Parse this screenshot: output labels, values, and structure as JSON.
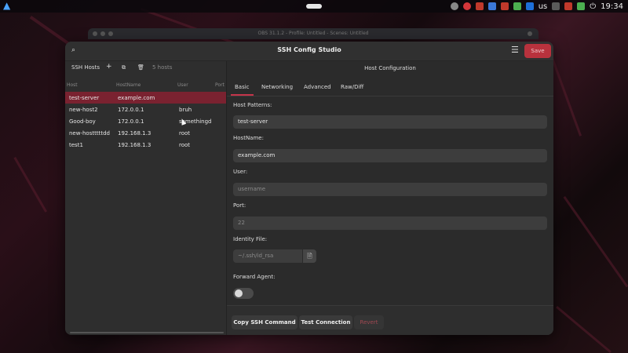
{
  "system": {
    "clock": "19:34",
    "keyboard_layout": "us"
  },
  "obs_title": "OBS 31.1.2 - Profile: Untitled - Scenes: Untitled",
  "app": {
    "title": "SSH Config Studio",
    "save_label": "Save"
  },
  "sidebar": {
    "title": "SSH Hosts",
    "host_count": "5 hosts",
    "columns": [
      "Host",
      "HostName",
      "User",
      "Port"
    ],
    "rows": [
      {
        "host": "test-server",
        "hostname": "example.com",
        "user": "",
        "port": "",
        "selected": true
      },
      {
        "host": "new-host2",
        "hostname": "172.0.0.1",
        "user": "bruh",
        "port": ""
      },
      {
        "host": "Good-boy",
        "hostname": "172.0.0.1",
        "user": "somethingd",
        "port": ""
      },
      {
        "host": "new-hostttttdd",
        "hostname": "192.168.1.3",
        "user": "root",
        "port": ""
      },
      {
        "host": "test1",
        "hostname": "192.168.1.3",
        "user": "root",
        "port": ""
      }
    ]
  },
  "config": {
    "heading": "Host Configuration",
    "tabs": [
      "Basic",
      "Networking",
      "Advanced",
      "Raw/Diff"
    ],
    "active_tab": "Basic",
    "host_patterns_label": "Host Patterns:",
    "host_patterns_value": "test-server",
    "hostname_label": "HostName:",
    "hostname_value": "example.com",
    "user_label": "User:",
    "user_placeholder": "username",
    "port_label": "Port:",
    "port_placeholder": "22",
    "identity_label": "Identity File:",
    "identity_placeholder": "~/.ssh/id_rsa",
    "forward_agent_label": "Forward Agent:",
    "forward_agent_on": false
  },
  "footer": {
    "copy_label": "Copy SSH Command",
    "test_label": "Test Connection",
    "revert_label": "Revert"
  }
}
